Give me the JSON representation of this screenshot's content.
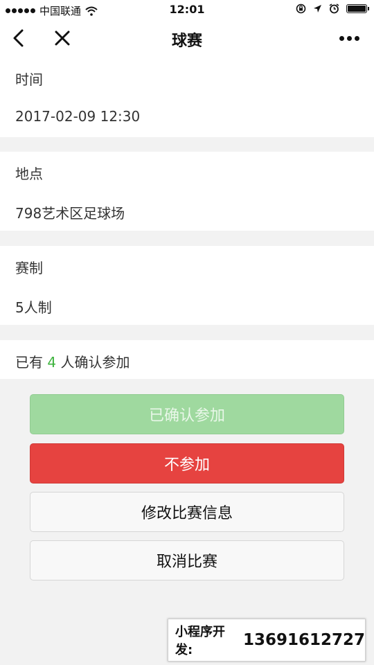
{
  "status_bar": {
    "carrier": "中国联通",
    "time": "12:01"
  },
  "nav": {
    "title": "球赛"
  },
  "details": {
    "time_label": "时间",
    "time_value": "2017-02-09 12:30",
    "location_label": "地点",
    "location_value": "798艺术区足球场",
    "format_label": "赛制",
    "format_value": "5人制"
  },
  "attendance": {
    "prefix": "已有",
    "count": "4",
    "suffix": "人确认参加"
  },
  "buttons": {
    "confirmed": "已确认参加",
    "decline": "不参加",
    "edit": "修改比赛信息",
    "cancel": "取消比赛"
  },
  "banner": {
    "label": "小程序开发:",
    "phone": "13691612727"
  },
  "colors": {
    "confirmed_button": "#9fd99f",
    "decline_button": "#e64340",
    "count_highlight": "#3eb33e"
  }
}
